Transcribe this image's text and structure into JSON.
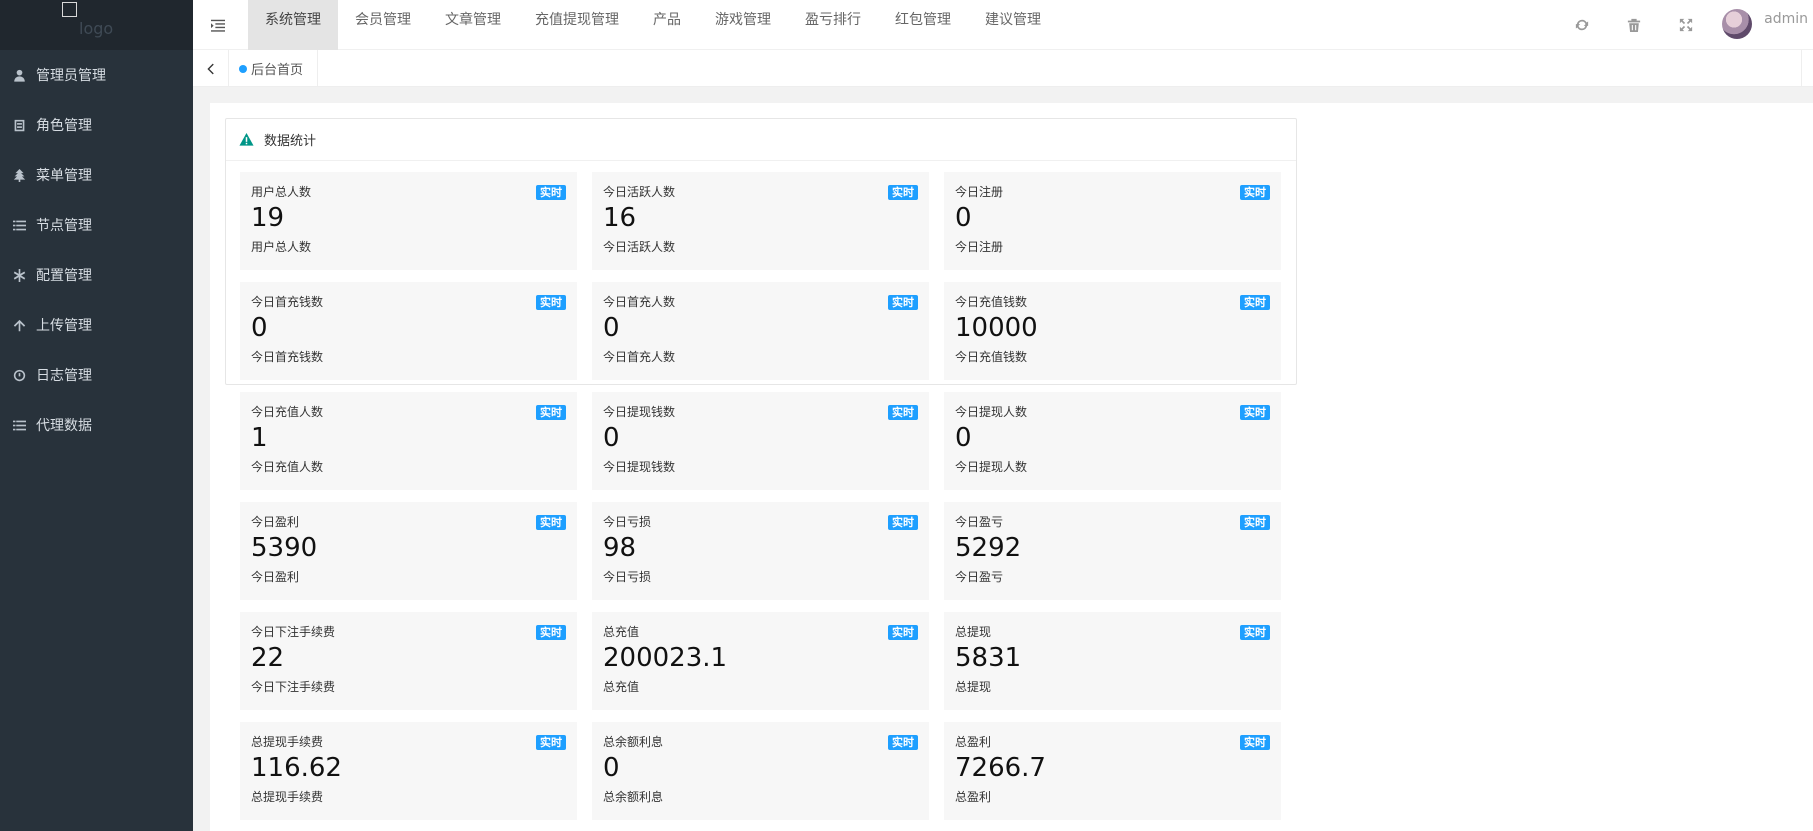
{
  "logo": {
    "text": "logo"
  },
  "sidebar": {
    "items": [
      {
        "label": "管理员管理",
        "icon": "user-icon"
      },
      {
        "label": "角色管理",
        "icon": "id-card-icon"
      },
      {
        "label": "菜单管理",
        "icon": "tree-icon"
      },
      {
        "label": "节点管理",
        "icon": "list-icon"
      },
      {
        "label": "配置管理",
        "icon": "asterisk-icon"
      },
      {
        "label": "上传管理",
        "icon": "arrow-up-icon"
      },
      {
        "label": "日志管理",
        "icon": "gauge-icon"
      },
      {
        "label": "代理数据",
        "icon": "list-icon"
      }
    ]
  },
  "topnav": {
    "tabs": [
      "系统管理",
      "会员管理",
      "文章管理",
      "充值提现管理",
      "产品",
      "游戏管理",
      "盈亏排行",
      "红包管理",
      "建议管理"
    ],
    "active_index": 0,
    "user": "admin"
  },
  "tabbar": {
    "current_tab": "后台首页"
  },
  "panel": {
    "title": "数据统计"
  },
  "colors": {
    "sidebar_bg": "#28323b",
    "accent": "#1e9fff",
    "card_bg": "#f7f7f7"
  },
  "stats": [
    {
      "label": "用户总人数",
      "badge": "实时",
      "value": "19",
      "sub": "用户总人数"
    },
    {
      "label": "今日活跃人数",
      "badge": "实时",
      "value": "16",
      "sub": "今日活跃人数"
    },
    {
      "label": "今日注册",
      "badge": "实时",
      "value": "0",
      "sub": "今日注册"
    },
    {
      "label": "今日首充钱数",
      "badge": "实时",
      "value": "0",
      "sub": "今日首充钱数"
    },
    {
      "label": "今日首充人数",
      "badge": "实时",
      "value": "0",
      "sub": "今日首充人数"
    },
    {
      "label": "今日充值钱数",
      "badge": "实时",
      "value": "10000",
      "sub": "今日充值钱数"
    },
    {
      "label": "今日充值人数",
      "badge": "实时",
      "value": "1",
      "sub": "今日充值人数"
    },
    {
      "label": "今日提现钱数",
      "badge": "实时",
      "value": "0",
      "sub": "今日提现钱数"
    },
    {
      "label": "今日提现人数",
      "badge": "实时",
      "value": "0",
      "sub": "今日提现人数"
    },
    {
      "label": "今日盈利",
      "badge": "实时",
      "value": "5390",
      "sub": "今日盈利"
    },
    {
      "label": "今日亏损",
      "badge": "实时",
      "value": "98",
      "sub": "今日亏损"
    },
    {
      "label": "今日盈亏",
      "badge": "实时",
      "value": "5292",
      "sub": "今日盈亏"
    },
    {
      "label": "今日下注手续费",
      "badge": "实时",
      "value": "22",
      "sub": "今日下注手续费"
    },
    {
      "label": "总充值",
      "badge": "实时",
      "value": "200023.1",
      "sub": "总充值"
    },
    {
      "label": "总提现",
      "badge": "实时",
      "value": "5831",
      "sub": "总提现"
    },
    {
      "label": "总提现手续费",
      "badge": "实时",
      "value": "116.62",
      "sub": "总提现手续费"
    },
    {
      "label": "总余额利息",
      "badge": "实时",
      "value": "0",
      "sub": "总余额利息"
    },
    {
      "label": "总盈利",
      "badge": "实时",
      "value": "7266.7",
      "sub": "总盈利"
    }
  ]
}
